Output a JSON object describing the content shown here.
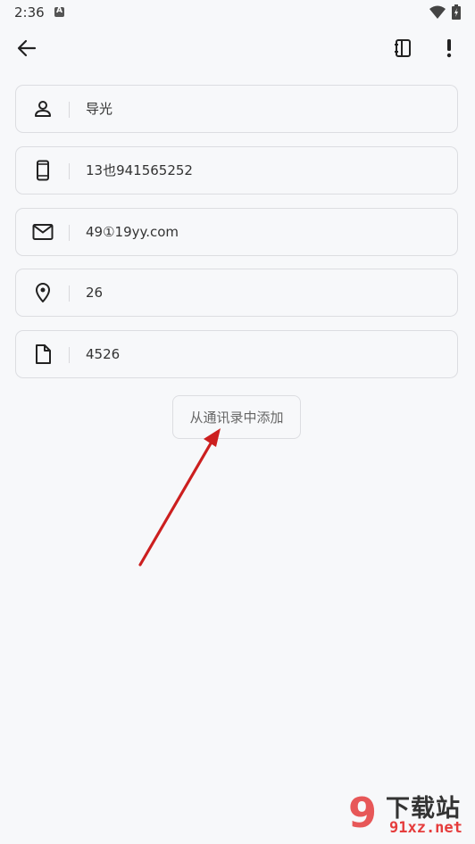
{
  "status": {
    "time": "2:36",
    "notif_letter": "A"
  },
  "toolbar": {
    "back_icon": "arrow-left-icon",
    "book_icon": "contact-book-icon",
    "more_icon": "exclamation-icon"
  },
  "fields": [
    {
      "icon": "person-icon",
      "value": "导光"
    },
    {
      "icon": "phone-icon",
      "value": "13也941565252"
    },
    {
      "icon": "mail-icon",
      "value": "49①19yy.com"
    },
    {
      "icon": "location-icon",
      "value": "26"
    },
    {
      "icon": "file-icon",
      "value": "4526"
    }
  ],
  "add_button": {
    "label": "从通讯录中添加"
  },
  "watermark": {
    "number": "9",
    "title": "下载站",
    "site": "91xz.net"
  },
  "colors": {
    "background": "#f7f8fa",
    "arrow": "#cc1f1f",
    "watermark_red": "#e53c3c"
  }
}
